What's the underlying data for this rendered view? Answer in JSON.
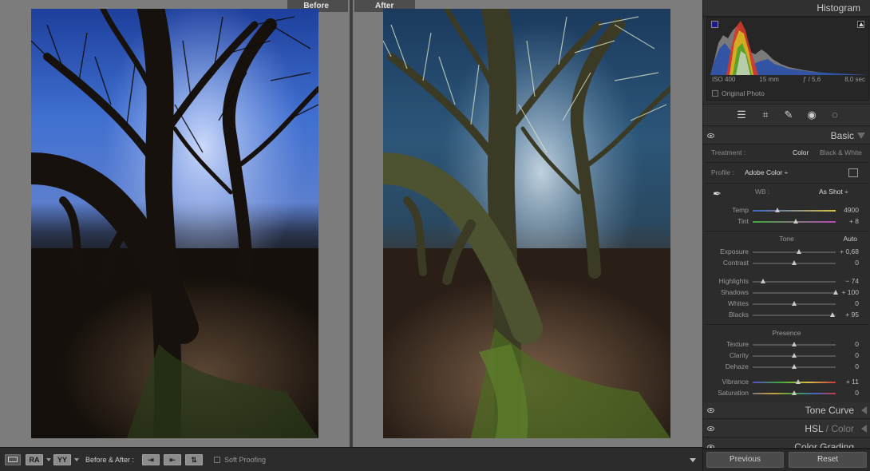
{
  "viewer": {
    "before_label": "Before",
    "after_label": "After"
  },
  "histogram": {
    "title": "Histogram",
    "iso": "ISO 400",
    "focal": "15 mm",
    "aperture": "ƒ / 5,6",
    "shutter": "8,0 sec",
    "original_photo": "Original Photo"
  },
  "basic": {
    "title": "Basic",
    "treatment_label": "Treatment :",
    "treatment_color": "Color",
    "treatment_bw": "Black & White",
    "profile_label": "Profile :",
    "profile_value": "Adobe Color ÷",
    "wb_label": "WB :",
    "wb_value": "As Shot ÷",
    "tone_label": "Tone",
    "auto_label": "Auto",
    "presence_label": "Presence",
    "sliders": {
      "temp": {
        "label": "Temp",
        "value": "4900",
        "pos": 0.3
      },
      "tint": {
        "label": "Tint",
        "value": "+ 8",
        "pos": 0.52
      },
      "exposure": {
        "label": "Exposure",
        "value": "+ 0,68",
        "pos": 0.56
      },
      "contrast": {
        "label": "Contrast",
        "value": "0",
        "pos": 0.5
      },
      "highlights": {
        "label": "Highlights",
        "value": "− 74",
        "pos": 0.13
      },
      "shadows": {
        "label": "Shadows",
        "value": "+ 100",
        "pos": 1.0
      },
      "whites": {
        "label": "Whites",
        "value": "0",
        "pos": 0.5
      },
      "blacks": {
        "label": "Blacks",
        "value": "+ 95",
        "pos": 0.97
      },
      "texture": {
        "label": "Texture",
        "value": "0",
        "pos": 0.5
      },
      "clarity": {
        "label": "Clarity",
        "value": "0",
        "pos": 0.5
      },
      "dehaze": {
        "label": "Dehaze",
        "value": "0",
        "pos": 0.5
      },
      "vibrance": {
        "label": "Vibrance",
        "value": "+ 11",
        "pos": 0.555
      },
      "saturation": {
        "label": "Saturation",
        "value": "0",
        "pos": 0.5
      }
    }
  },
  "panels": {
    "tone_curve": "Tone Curve",
    "hsl": "HSL",
    "hsl_sep": " / ",
    "hsl_color": "Color",
    "color_grading": "Color Grading"
  },
  "buttons": {
    "previous": "Previous",
    "reset": "Reset"
  },
  "toolbar": {
    "before_after_label": "Before & After :",
    "soft_proofing": "Soft Proofing",
    "view_ra": "RA",
    "view_yy": "YY"
  },
  "colors": {
    "accent_blue": "#2b4fa8",
    "panel_bg": "#2d2d2d",
    "viewer_bg": "#7c7c7c"
  }
}
